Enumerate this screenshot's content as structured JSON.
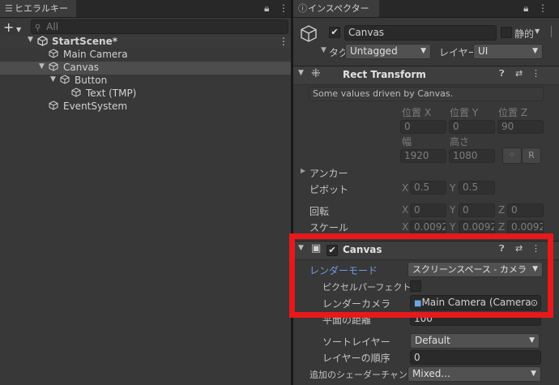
{
  "hierarchy": {
    "tab_label": "ヒエラルキー",
    "search_placeholder": "All",
    "add_symbol": "+",
    "items": [
      {
        "label": "StartScene*"
      },
      {
        "label": "Main Camera"
      },
      {
        "label": "Canvas"
      },
      {
        "label": "Button"
      },
      {
        "label": "Text (TMP)"
      },
      {
        "label": "EventSystem"
      }
    ]
  },
  "inspector": {
    "tab_label": "インスペクター",
    "object_name": "Canvas",
    "static_label": "静的",
    "tag_label": "タグ",
    "tag_value": "Untagged",
    "layer_label": "レイヤー",
    "layer_value": "UI",
    "rect_transform": {
      "title": "Rect Transform",
      "note": "Some values driven by Canvas.",
      "pos_x_label": "位置 X",
      "pos_y_label": "位置 Y",
      "pos_z_label": "位置 Z",
      "pos_x": "0",
      "pos_y": "0",
      "pos_z": "90",
      "width_label": "幅",
      "height_label": "高さ",
      "width": "1920",
      "height": "1080",
      "r_button": "R",
      "anchor_label": "アンカー",
      "pivot_label": "ピボット",
      "pivot_x_label": "X",
      "pivot_x": "0.5",
      "pivot_y_label": "Y",
      "pivot_y": "0.5",
      "rotation_label": "回転",
      "rot_x_label": "X",
      "rot_x": "0",
      "rot_y_label": "Y",
      "rot_y": "0",
      "rot_z_label": "Z",
      "rot_z": "0",
      "scale_label": "スケール",
      "scale_x_label": "X",
      "scale_x": "0.0092",
      "scale_y_label": "Y",
      "scale_y": "0.0092",
      "scale_z_label": "Z",
      "scale_z": "0.0092"
    },
    "canvas": {
      "title": "Canvas",
      "render_mode_label": "レンダーモード",
      "render_mode_value": "スクリーンスペース - カメラ",
      "pixel_perfect_label": "ピクセルパーフェクト",
      "render_camera_label": "レンダーカメラ",
      "render_camera_value": "Main Camera (Camera)",
      "plane_distance_label": "平面の距離",
      "plane_distance_value": "100",
      "sorting_layer_label": "ソートレイヤー",
      "sorting_layer_value": "Default",
      "order_in_layer_label": "レイヤーの順序",
      "order_in_layer_value": "0",
      "shader_channels_label": "追加のシェーダーチャンネル",
      "shader_channels_value": "Mixed..."
    }
  },
  "colors": {
    "highlight_border": "#e8181b",
    "selected_row": "#4d4d4d",
    "render_mode_label": "#6e9be0"
  }
}
